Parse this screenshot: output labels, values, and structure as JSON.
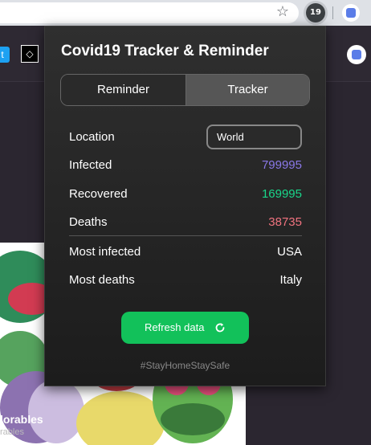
{
  "browser": {
    "star_icon": "star-icon",
    "extension_badge": "19",
    "profile_icon": "profile-icon"
  },
  "page": {
    "art_title": "lorables",
    "art_subtitle": "rables"
  },
  "popup": {
    "title": "Covid19 Tracker & Reminder",
    "tabs": [
      {
        "label": "Reminder",
        "active": false
      },
      {
        "label": "Tracker",
        "active": true
      }
    ],
    "location": {
      "label": "Location",
      "value": "World"
    },
    "stats": {
      "infected": {
        "label": "Infected",
        "value": "799995",
        "color": "#8a78e8"
      },
      "recovered": {
        "label": "Recovered",
        "value": "169995",
        "color": "#19d68a"
      },
      "deaths": {
        "label": "Deaths",
        "value": "38735",
        "color": "#f0737f"
      }
    },
    "most": {
      "infected": {
        "label": "Most infected",
        "value": "USA"
      },
      "deaths": {
        "label": "Most deaths",
        "value": "Italy"
      }
    },
    "refresh_label": "Refresh data",
    "refresh_icon": "refresh-icon",
    "hashtag": "#StayHomeStaySafe"
  },
  "colors": {
    "accent_green": "#12c15a",
    "popup_bg": "#2a2a2a"
  }
}
